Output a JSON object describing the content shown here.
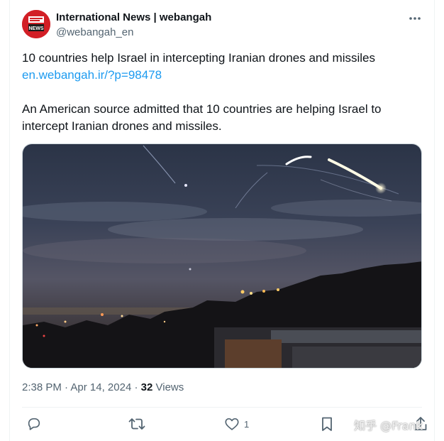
{
  "author": {
    "display_name": "International News | webangah",
    "handle": "@webangah_en",
    "avatar_icon": "news-logo-icon",
    "avatar_color": "#d21f26"
  },
  "tweet": {
    "headline": "10 countries help Israel in intercepting Iranian drones and missiles",
    "link": "en.webangah.ir/?p=98478",
    "body": "An American source admitted that 10 countries are helping Israel to intercept Iranian drones and missiles."
  },
  "meta": {
    "time": "2:38 PM",
    "separator": "·",
    "date": "Apr 14, 2024",
    "views_count": "32",
    "views_label": "Views"
  },
  "actions": {
    "reply_icon": "reply-icon",
    "retweet_icon": "retweet-icon",
    "like_icon": "heart-icon",
    "like_count": "1",
    "bookmark_icon": "bookmark-icon",
    "share_icon": "share-icon"
  },
  "watermark": "知乎 @Frank",
  "colors": {
    "link": "#1d9bf0",
    "secondary_text": "#536471",
    "primary_text": "#0f1419"
  }
}
